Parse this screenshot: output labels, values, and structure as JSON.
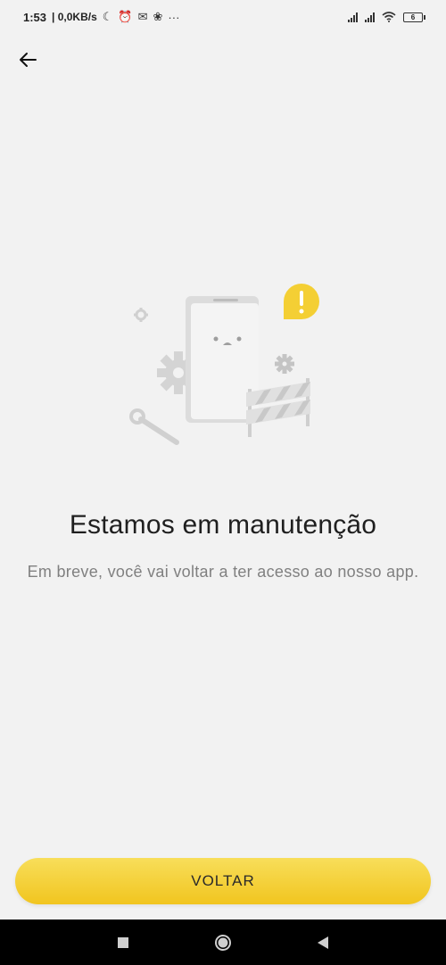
{
  "status_bar": {
    "time": "1:53",
    "network_speed": "| 0,0KB/s",
    "extra": "···",
    "battery_level": "6"
  },
  "icons": {
    "back": "arrow-left-icon",
    "status": [
      "moon-icon",
      "alarm-icon",
      "notification-icon",
      "app-icon",
      "signal-icon",
      "wifi-icon",
      "battery-icon"
    ],
    "nav": [
      "square-icon",
      "circle-icon",
      "triangle-icon"
    ]
  },
  "main": {
    "title": "Estamos em manutenção",
    "subtitle": "Em breve, você vai voltar a ter acesso ao nosso app."
  },
  "footer": {
    "button_label": "VOLTAR"
  },
  "colors": {
    "background": "#f2f2f2",
    "accent": "#f4cf34",
    "title": "#1f1f1f",
    "subtitle": "#808080"
  }
}
